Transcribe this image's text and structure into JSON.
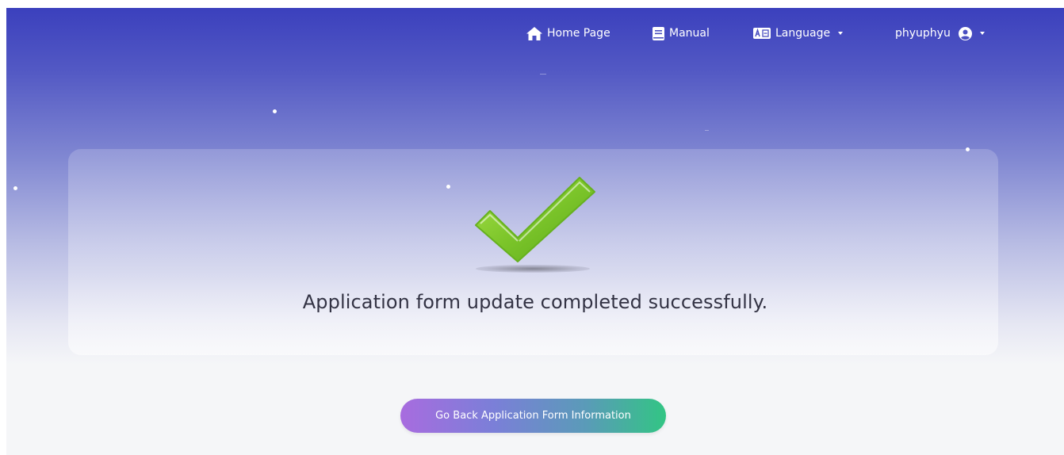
{
  "nav": {
    "home_label": "Home Page",
    "manual_label": "Manual",
    "language_label": "Language",
    "user_label": "phyuphyu"
  },
  "message": "Application form update completed successfully.",
  "back_button_label": "Go Back Application Form Information",
  "colors": {
    "header_top": "#3b40bd",
    "page_bottom": "#f5f6f8",
    "check_green": "#7cc52a",
    "button_start": "#a86cdf",
    "button_end": "#32c584"
  },
  "icons": [
    "home-icon",
    "book-icon",
    "language-icon",
    "user-circle-icon",
    "chevron-down-icon",
    "check-icon"
  ]
}
